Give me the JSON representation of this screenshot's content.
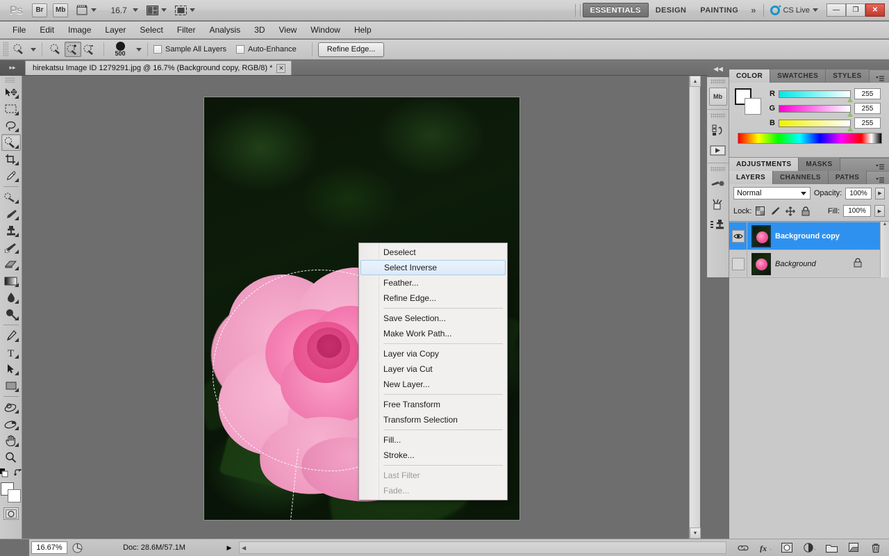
{
  "app": {
    "logo": "Ps",
    "bridge_label": "Br",
    "minibridge_label": "Mb",
    "zoom_level": "16.7",
    "workspaces": [
      {
        "label": "ESSENTIALS",
        "active": true
      },
      {
        "label": "DESIGN",
        "active": false
      },
      {
        "label": "PAINTING",
        "active": false
      }
    ],
    "more_workspaces": "»",
    "cs_live": "CS Live",
    "window_buttons": {
      "minimize": "—",
      "restore": "❐",
      "close": "✕"
    }
  },
  "menubar": {
    "items": [
      "File",
      "Edit",
      "Image",
      "Layer",
      "Select",
      "Filter",
      "Analysis",
      "3D",
      "View",
      "Window",
      "Help"
    ]
  },
  "options_bar": {
    "tool_preset_label": "quick-selection-tool",
    "modes": [
      "new-selection",
      "add-to-selection",
      "subtract-from-selection"
    ],
    "active_mode_index": 1,
    "brush_size": "500",
    "sample_all_layers": {
      "label": "Sample All Layers",
      "checked": false
    },
    "auto_enhance": {
      "label": "Auto-Enhance",
      "checked": false
    },
    "refine_edge": "Refine Edge..."
  },
  "document_tab": {
    "title": "hirekatsu Image ID 1279291.jpg @ 16.7% (Background copy, RGB/8) *",
    "close": "✕"
  },
  "toolbar": {
    "tools": [
      {
        "name": "move-tool",
        "glyph": "✣"
      },
      {
        "name": "marquee-tool",
        "glyph": "▢"
      },
      {
        "name": "lasso-tool",
        "glyph": "❦"
      },
      {
        "name": "quick-selection-tool",
        "glyph": "◌"
      },
      {
        "name": "crop-tool",
        "glyph": "⌗"
      },
      {
        "name": "eyedropper-tool",
        "glyph": "✒"
      },
      {
        "name": "spot-healing-brush-tool",
        "glyph": "☂"
      },
      {
        "name": "brush-tool",
        "glyph": "✎"
      },
      {
        "name": "clone-stamp-tool",
        "glyph": "⚑"
      },
      {
        "name": "history-brush-tool",
        "glyph": "✐"
      },
      {
        "name": "eraser-tool",
        "glyph": "▰"
      },
      {
        "name": "gradient-tool",
        "glyph": "▤"
      },
      {
        "name": "blur-tool",
        "glyph": "●"
      },
      {
        "name": "dodge-tool",
        "glyph": "⚬"
      },
      {
        "name": "pen-tool",
        "glyph": "✑"
      },
      {
        "name": "type-tool",
        "glyph": "T"
      },
      {
        "name": "path-selection-tool",
        "glyph": "➤"
      },
      {
        "name": "rectangle-tool",
        "glyph": "▭"
      },
      {
        "name": "3d-rotate-tool",
        "glyph": "◔"
      },
      {
        "name": "3d-orbit-tool",
        "glyph": "◑"
      },
      {
        "name": "hand-tool",
        "glyph": "✋"
      },
      {
        "name": "zoom-tool",
        "glyph": "⚲"
      }
    ],
    "active_tool_index": 3,
    "foreground_color": "#ffffff",
    "background_color": "#ffffff",
    "quick_mask_label": "quick-mask-mode"
  },
  "context_menu": {
    "groups": [
      [
        {
          "label": "Deselect",
          "state": "normal"
        },
        {
          "label": "Select Inverse",
          "state": "highlighted"
        },
        {
          "label": "Feather...",
          "state": "normal"
        },
        {
          "label": "Refine Edge...",
          "state": "normal"
        }
      ],
      [
        {
          "label": "Save Selection...",
          "state": "normal"
        },
        {
          "label": "Make Work Path...",
          "state": "normal"
        }
      ],
      [
        {
          "label": "Layer via Copy",
          "state": "normal"
        },
        {
          "label": "Layer via Cut",
          "state": "normal"
        },
        {
          "label": "New Layer...",
          "state": "normal"
        }
      ],
      [
        {
          "label": "Free Transform",
          "state": "normal"
        },
        {
          "label": "Transform Selection",
          "state": "normal"
        }
      ],
      [
        {
          "label": "Fill...",
          "state": "normal"
        },
        {
          "label": "Stroke...",
          "state": "normal"
        }
      ],
      [
        {
          "label": "Last Filter",
          "state": "disabled"
        },
        {
          "label": "Fade...",
          "state": "disabled"
        }
      ]
    ]
  },
  "dock": {
    "collapse": "◀◀",
    "items": [
      {
        "name": "mini-bridge-button",
        "label": "Mb"
      },
      {
        "name": "history-panel-icon",
        "label": "↺"
      },
      {
        "name": "actions-panel-icon",
        "label": "▶"
      },
      {
        "name": "brush-panel-icon",
        "label": "✒"
      },
      {
        "name": "tool-presets-icon",
        "label": "✂"
      },
      {
        "name": "clone-source-icon",
        "label": "⚑"
      }
    ]
  },
  "color_panel": {
    "tabs": [
      {
        "label": "COLOR",
        "active": true
      },
      {
        "label": "SWATCHES",
        "active": false
      },
      {
        "label": "STYLES",
        "active": false
      }
    ],
    "channels": [
      {
        "label": "R",
        "value": "255"
      },
      {
        "label": "G",
        "value": "255"
      },
      {
        "label": "B",
        "value": "255"
      }
    ]
  },
  "adjustments_panel": {
    "tabs": [
      {
        "label": "ADJUSTMENTS",
        "active": true
      },
      {
        "label": "MASKS",
        "active": false
      }
    ]
  },
  "layers_panel": {
    "tabs": [
      {
        "label": "LAYERS",
        "active": true
      },
      {
        "label": "CHANNELS",
        "active": false
      },
      {
        "label": "PATHS",
        "active": false
      }
    ],
    "blend_mode": "Normal",
    "opacity_label": "Opacity:",
    "opacity_value": "100%",
    "lock_label": "Lock:",
    "fill_label": "Fill:",
    "fill_value": "100%",
    "lock_icons": [
      "lock-transparent-pixels-icon",
      "lock-image-pixels-icon",
      "lock-position-icon",
      "lock-all-icon"
    ],
    "layers": [
      {
        "name": "Background copy",
        "selected": true,
        "visible": true,
        "locked": false,
        "italic": false
      },
      {
        "name": "Background",
        "selected": false,
        "visible": false,
        "locked": true,
        "italic": true
      }
    ],
    "footer_icons": [
      {
        "name": "link-layers-icon",
        "glyph": "⚭"
      },
      {
        "name": "layer-style-icon",
        "glyph": "fx"
      },
      {
        "name": "layer-mask-icon",
        "glyph": "▣"
      },
      {
        "name": "adjustment-layer-icon",
        "glyph": "◑"
      },
      {
        "name": "new-group-icon",
        "glyph": "▭"
      },
      {
        "name": "new-layer-icon",
        "glyph": "❐"
      },
      {
        "name": "delete-layer-icon",
        "glyph": "☒"
      }
    ]
  },
  "status_bar": {
    "zoom": "16.67%",
    "doc_info": "Doc: 28.6M/57.1M",
    "arrow": "▶"
  }
}
